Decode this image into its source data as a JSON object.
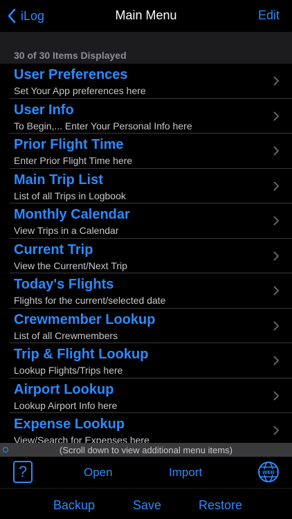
{
  "nav": {
    "back_label": "iLog",
    "title": "Main Menu",
    "edit_label": "Edit"
  },
  "list_header": "30 of 30 Items Displayed",
  "menu_items": [
    {
      "title": "User Preferences",
      "subtitle": "Set Your App preferences here"
    },
    {
      "title": "User Info",
      "subtitle": "To Begin,... Enter Your Personal Info here"
    },
    {
      "title": "Prior Flight Time",
      "subtitle": "Enter Prior Flight Time here"
    },
    {
      "title": "Main Trip List",
      "subtitle": "List of all Trips in Logbook"
    },
    {
      "title": "Monthly Calendar",
      "subtitle": "View Trips in a Calendar"
    },
    {
      "title": "Current Trip",
      "subtitle": "View the Current/Next Trip"
    },
    {
      "title": "Today's Flights",
      "subtitle": "Flights for the current/selected date"
    },
    {
      "title": "Crewmember Lookup",
      "subtitle": "List of all Crewmembers"
    },
    {
      "title": "Trip & Flight Lookup",
      "subtitle": "Lookup Flights/Trips here"
    },
    {
      "title": "Airport Lookup",
      "subtitle": "Lookup Airport Info here"
    },
    {
      "title": "Expense Lookup",
      "subtitle": "View/Search for Expenses here"
    }
  ],
  "scroll_hint": "(Scroll down to view additional menu items)",
  "toolbar": {
    "help_label": "?",
    "open_label": "Open",
    "import_label": "Import",
    "web_icon_text": "WEB"
  },
  "bottom_bar": {
    "backup_label": "Backup",
    "save_label": "Save",
    "restore_label": "Restore"
  },
  "colors": {
    "accent": "#2a8bff",
    "background": "#000000",
    "header_bg": "#1c1c1e",
    "separator": "#3a3a3c"
  }
}
